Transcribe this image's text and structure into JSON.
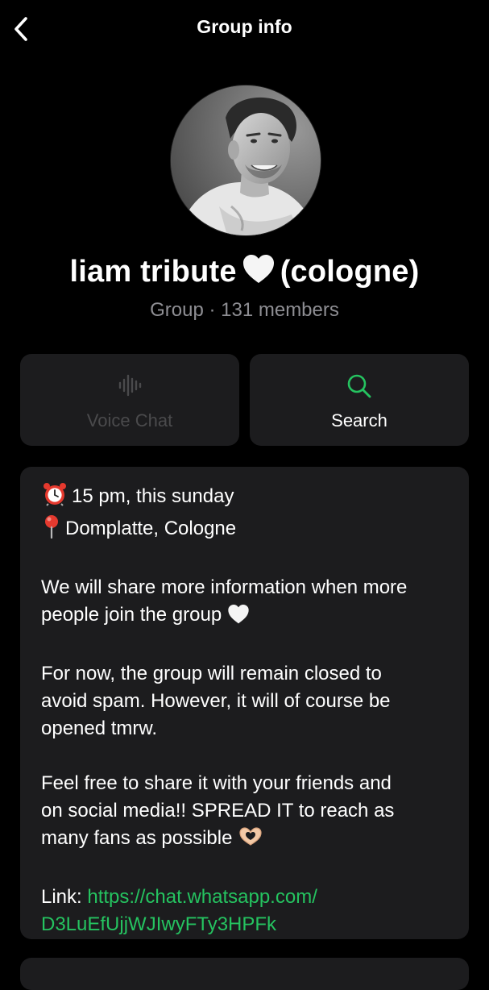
{
  "header": {
    "title": "Group info"
  },
  "group": {
    "name": "liam tribute",
    "name_suffix": "(cologne)",
    "subtitle": "Group · 131 members"
  },
  "actions": {
    "voice_chat": "Voice Chat",
    "search": "Search"
  },
  "description": {
    "time": "15 pm, this sunday",
    "place": "Domplatte, Cologne",
    "p1_l1": "We will share more information when more",
    "p1_l2": "people join the group",
    "p2_l1": "For now, the group will remain closed to",
    "p2_l2": "avoid spam. However, it will of course be",
    "p2_l3": "opened tmrw.",
    "p3_l1": "Feel free to share it with your friends and",
    "p3_l2": "on social media!! SPREAD IT to reach as",
    "p3_l3": "many fans as possible",
    "link_label": "Link:",
    "link_l1": "https://chat.whatsapp.com/",
    "link_l2": "D3LuEfUjjWJIwyFTy3HPFk"
  },
  "colors": {
    "background": "#000000",
    "card": "#1c1c1e",
    "accent_green": "#25c360",
    "secondary_text": "#8e8e93",
    "disabled_text": "#4a4a4c"
  },
  "icons": {
    "back": "chevron-left-icon",
    "voice": "waveform-icon",
    "search": "search-icon",
    "alarm": "alarm-clock-icon",
    "pin": "pushpin-icon",
    "heart": "white-heart-icon",
    "hands": "heart-hands-icon"
  }
}
